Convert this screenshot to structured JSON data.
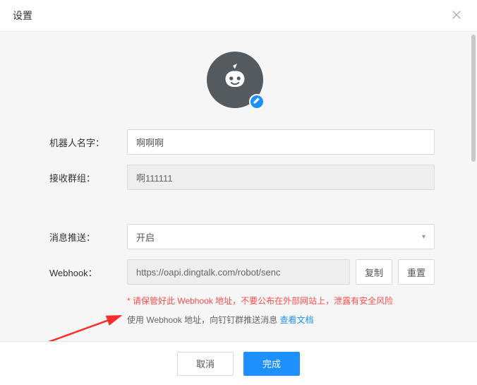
{
  "title": "设置",
  "avatar": {
    "icon": "robot-icon",
    "edit_icon": "pencil-icon"
  },
  "form": {
    "robot_name": {
      "label": "机器人名字：",
      "value": "啊啊啊"
    },
    "recv_group": {
      "label": "接收群组：",
      "value": "啊111111"
    },
    "push": {
      "label": "消息推送：",
      "value": "开启"
    },
    "webhook": {
      "label": "Webhook：",
      "value": "https://oapi.dingtalk.com/robot/senc",
      "copy": "复制",
      "reset": "重置"
    },
    "warning": "* 请保管好此 Webhook 地址，不要公布在外部网站上，泄露有安全风险",
    "help_prefix": "使用 Webhook 地址，向钉钉群推送消息 ",
    "help_link": "查看文档"
  },
  "footer": {
    "cancel": "取消",
    "ok": "完成"
  }
}
